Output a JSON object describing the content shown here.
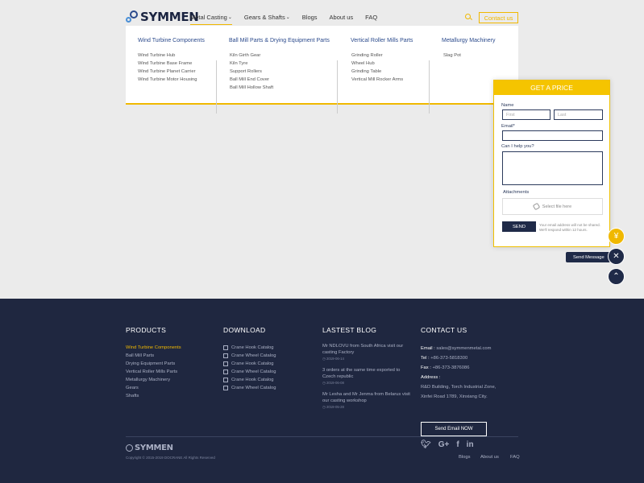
{
  "brand": {
    "name": "SYMMEN"
  },
  "nav": [
    {
      "label": "Metal Casting",
      "active": true,
      "dropdown": true
    },
    {
      "label": "Gears & Shafts",
      "active": false,
      "dropdown": true
    },
    {
      "label": "Blogs",
      "active": false,
      "dropdown": false
    },
    {
      "label": "About us",
      "active": false,
      "dropdown": false
    },
    {
      "label": "FAQ",
      "active": false,
      "dropdown": false
    }
  ],
  "header": {
    "contact_label": "Contact us",
    "accent": "#f0b800"
  },
  "mega_menu": [
    {
      "heading": "Wind Turbine Components",
      "links": [
        "Wind Turbine Hub",
        "Wind Turbine Base Frame",
        "Wind Turbine Planet Carrier",
        "Wind Turbine Motor Housing"
      ]
    },
    {
      "heading": "Ball Mill Parts & Drying Equipment Parts",
      "links": [
        "Kiln Girth Gear",
        "Kiln Tyre",
        "Support Rollers",
        "Ball Mill End Cover",
        "Ball Mill Hollow Shaft"
      ]
    },
    {
      "heading": "Vertical Roller Mills Parts",
      "links": [
        "Grinding Roller",
        "Wheel Hub",
        "Grinding Table",
        "Vertical Mill Rocker Arms"
      ]
    },
    {
      "heading": "Metallurgy Machinery",
      "links": [
        "Slag Pot"
      ]
    }
  ],
  "form": {
    "title": "GET A PRICE",
    "name_label": "Name",
    "first_placeholder": "First",
    "last_placeholder": "Last",
    "email_label": "Email*",
    "help_label": "Can I help you?",
    "attachments_label": "Attachments",
    "file_label": "Select file here",
    "send_label": "SEND",
    "note": "Your email address will not be shared. We'll respond within 12 hours."
  },
  "floating": {
    "send_message_label": "Send Message"
  },
  "footer": {
    "products": {
      "heading": "PRODUCTS",
      "items": [
        "Wind Turbine Components",
        "Ball Mill Parts",
        "Drying Equipment Parts",
        "Vertical Roller Mills Parts",
        "Metallurgy Machinery",
        "Gears",
        "Shafts"
      ]
    },
    "download": {
      "heading": "DOWNLOAD",
      "items": [
        "Crane Hook Catalog",
        "Crane Wheel Catalog",
        "Crane Hook Catalog",
        "Crane Wheel Catalog",
        "Crane Hook Catalog",
        "Crane Wheel Catalog"
      ]
    },
    "blog": {
      "heading": "LASTEST BLOG",
      "items": [
        {
          "title": "Mr NDLOVU from South Africa visit our casting Factory",
          "date": "2019-06-14"
        },
        {
          "title": "3 orders at the same time exported to Czech republic",
          "date": "2019-06-08"
        },
        {
          "title": "Mr Lesha and Mr Jenma from Belarus visit our casting workshop",
          "date": "2019-05-28"
        }
      ]
    },
    "contact": {
      "heading": "CONTACT US",
      "email_key": "Email :",
      "email": "sales@symmenmetal.com",
      "tel_key": "Tel :",
      "tel": "+86-373-5818300",
      "fax_key": "Fax :",
      "fax": "+86-373-3876086",
      "address_key": "Address :",
      "address_line1": "R&D Building, Torch Industrial Zone,",
      "address_line2": "Xinfei Road 1789, Xinxiang City.",
      "send_email_label": "Send Email NOW",
      "social": [
        "twitter-icon",
        "google-plus-icon",
        "facebook-icon",
        "linkedin-icon"
      ]
    },
    "bottom": {
      "brand": "SYMMEN",
      "copyright": "Copyright © 2015-2019 DOCRANE All Rights Reserved",
      "links": [
        "Blogs",
        "About us",
        "FAQ"
      ]
    }
  }
}
